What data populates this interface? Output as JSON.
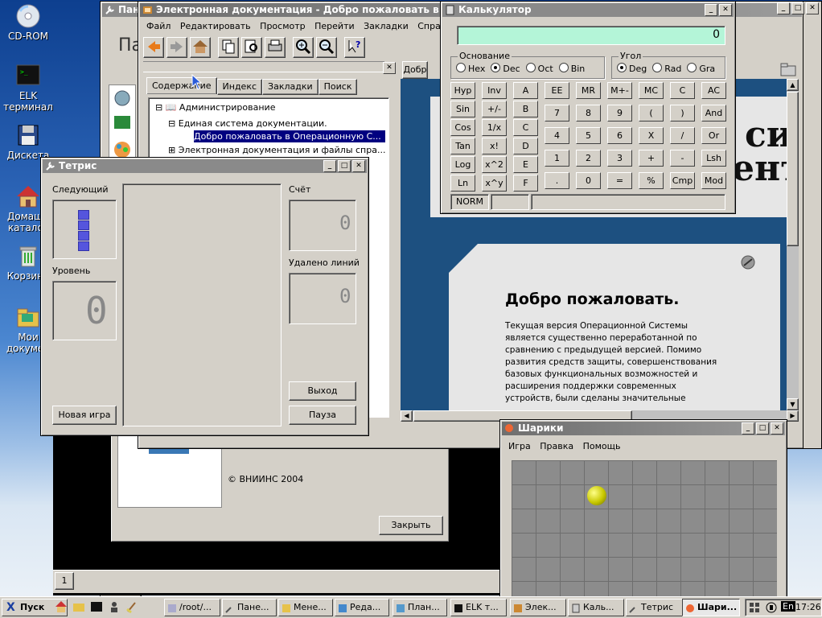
{
  "desktop": {
    "icons": [
      {
        "label": "CD-ROM",
        "icon": "cdrom-icon"
      },
      {
        "label": "ELK терминал",
        "icon": "terminal-icon"
      },
      {
        "label": "Дискета",
        "icon": "floppy-icon"
      },
      {
        "label": "Домашн каталог",
        "icon": "home-icon"
      },
      {
        "label": "Корзина",
        "icon": "trash-icon"
      },
      {
        "label": "Мои докумен",
        "icon": "documents-icon"
      }
    ]
  },
  "panel_window": {
    "title": "Пане",
    "big_text": "Па"
  },
  "doc_window": {
    "title": "Электронная документация - Добро пожаловать в Опера",
    "menu": [
      "Файл",
      "Редактировать",
      "Просмотр",
      "Перейти",
      "Закладки",
      "Справка"
    ],
    "tabs": [
      "Содержание",
      "Индекс",
      "Закладки",
      "Поиск"
    ],
    "tree": [
      "Администрирование",
      "Единая система документации.",
      "Добро пожаловать в Операционную С...",
      "Электронная документация и файлы спра..."
    ],
    "content_tab": "Добр",
    "big_heading_1": "сис",
    "big_heading_2": "ент",
    "welcome_title": "Добро пожаловать.",
    "welcome_text": [
      "Текущая версия Операционной Системы",
      "является существенно переработанной по",
      "сравнению с предыдущей версией. Помимо",
      "развития средств защиты, совершенствования",
      "базовых функциональных возможностей и",
      "расширения поддержки современных",
      "устройств, были сделаны значительные"
    ]
  },
  "about_window": {
    "copyright": "© ВНИИНС 2004",
    "close_label": "Закрыть"
  },
  "tetris": {
    "title": "Тетрис",
    "next_label": "Следующий",
    "level_label": "Уровень",
    "score_label": "Счёт",
    "lines_label": "Удалено линий",
    "level_value": "0",
    "score_value": "0",
    "lines_value": "0",
    "new_game": "Новая игра",
    "exit": "Выход",
    "pause": "Пауза"
  },
  "calculator": {
    "title": "Калькулятор",
    "display": "0",
    "base_label": "Основание",
    "bases": [
      "Hex",
      "Dec",
      "Oct",
      "Bin"
    ],
    "base_selected": "Dec",
    "angle_label": "Угол",
    "angles": [
      "Deg",
      "Rad",
      "Gra"
    ],
    "angle_selected": "Deg",
    "status": "NORM",
    "keys": [
      [
        "Hyp",
        "Inv",
        "A",
        "EE",
        "MR",
        "M+-",
        "MC",
        "C",
        "AC"
      ],
      [
        "Sin",
        "+/-",
        "B",
        "7",
        "8",
        "9",
        "(",
        ")",
        "And"
      ],
      [
        "Cos",
        "1/x",
        "C",
        "4",
        "5",
        "6",
        "X",
        "/",
        "Or"
      ],
      [
        "Tan",
        "x!",
        "D",
        "1",
        "2",
        "3",
        "+",
        "-",
        "Lsh"
      ],
      [
        "Log",
        "x^2",
        "E",
        ".",
        "0",
        "=",
        "%",
        "Cmp",
        "Mod"
      ],
      [
        "Ln",
        "x^y",
        "F"
      ]
    ]
  },
  "balls": {
    "title": "Шарики",
    "menu": [
      "Игра",
      "Правка",
      "Помощь"
    ],
    "ball_color": "#c8c800"
  },
  "terminal_tab": "1",
  "taskbar": {
    "start": "Пуск",
    "tasks": [
      "/root/...",
      "Пане...",
      "Мене...",
      "Реда...",
      "План...",
      "ELK т...",
      "Элек...",
      "Каль...",
      "Тетрис",
      "Шари..."
    ],
    "lang": "En",
    "clock": "17:26"
  }
}
